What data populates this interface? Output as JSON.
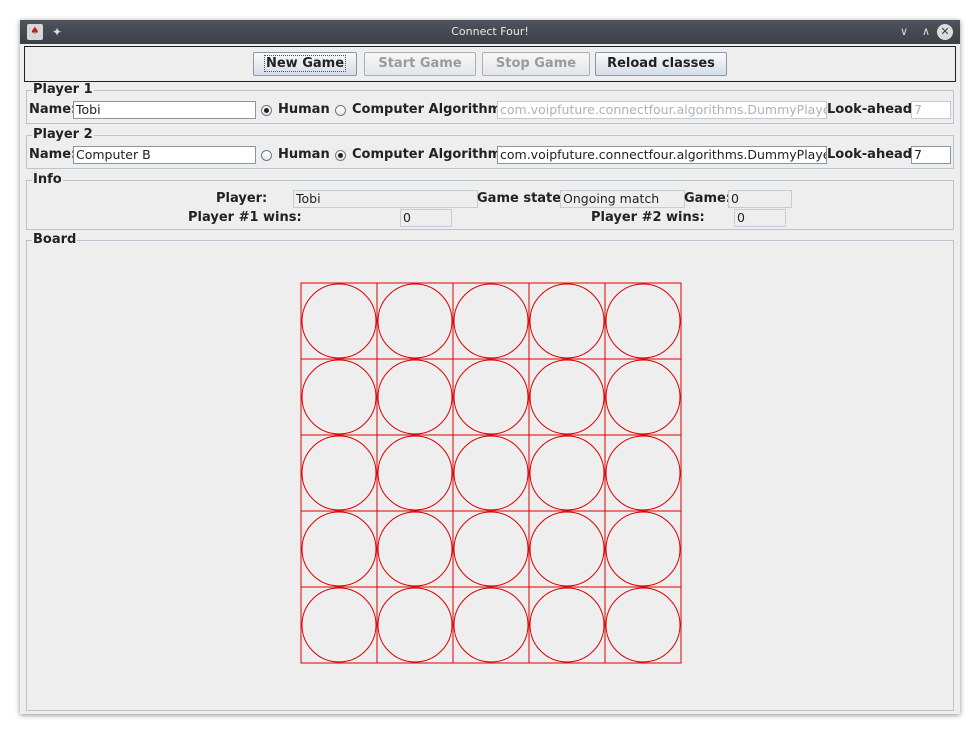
{
  "window": {
    "title": "Connect Four!"
  },
  "toolbar": {
    "new_game": "New Game",
    "start_game": "Start Game",
    "stop_game": "Stop Game",
    "reload_classes": "Reload classes"
  },
  "player1": {
    "legend": "Player 1",
    "name_label": "Name:",
    "name_value": "Tobi",
    "human_label": "Human",
    "computer_label": "Computer Algorithm:",
    "algorithm_value": "com.voipfuture.connectfour.algorithms.DummyPlayer",
    "lookahead_label": "Look-ahead:",
    "lookahead_value": "7",
    "selected": "Human"
  },
  "player2": {
    "legend": "Player 2",
    "name_label": "Name:",
    "name_value": "Computer B",
    "human_label": "Human",
    "computer_label": "Computer Algorithm:",
    "algorithm_value": "com.voipfuture.connectfour.algorithms.DummyPlayer",
    "lookahead_label": "Look-ahead:",
    "lookahead_value": "7",
    "selected": "Computer Algorithm"
  },
  "info": {
    "legend": "Info",
    "player_label": "Player:",
    "player_value": "Tobi",
    "game_state_label": "Game state:",
    "game_state_value": "Ongoing match",
    "game_label": "Game:",
    "game_value": "0",
    "p1_wins_label": "Player #1 wins:",
    "p1_wins_value": "0",
    "p2_wins_label": "Player #2 wins:",
    "p2_wins_value": "0"
  },
  "board": {
    "legend": "Board",
    "rows": 5,
    "columns": 5,
    "color": "#dd0000"
  }
}
